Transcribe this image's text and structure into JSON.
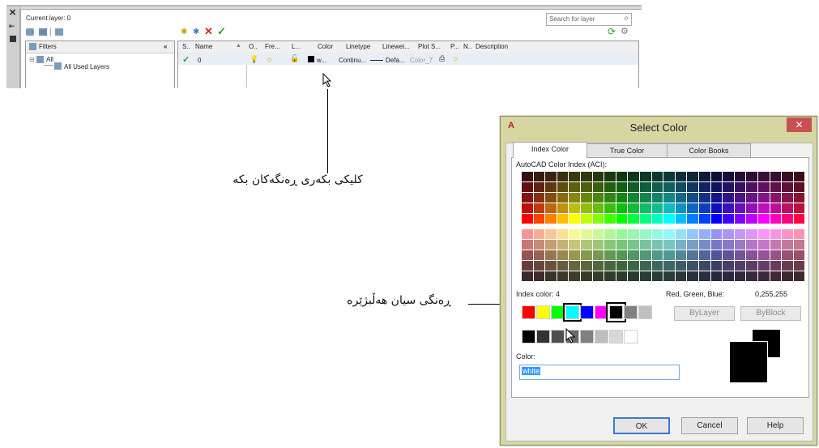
{
  "layer_manager": {
    "current_layer": "Current layer: 0",
    "search_placeholder": "Search for layer",
    "filters_label": "Filters",
    "tree": [
      "All",
      "All Used Layers"
    ],
    "columns": [
      "S..",
      "Name",
      "O..",
      "Fre...",
      "L...",
      "Color",
      "Linetype",
      "Linewei...",
      "Plot S...",
      "P...",
      "N..",
      "Description"
    ],
    "row": {
      "name": "0",
      "color": "w...",
      "linetype": "Continu...",
      "lineweight": "Defa...",
      "plot_style": "Color_7"
    }
  },
  "dialog": {
    "title": "Select Color",
    "tabs": [
      "Index Color",
      "True Color",
      "Color Books"
    ],
    "aci_label": "AutoCAD Color Index (ACI):",
    "index_color_label": "Index color: 4",
    "rgb_label": "Red, Green, Blue:",
    "rgb_value": "0,255,255",
    "bylayer": "ByLayer",
    "byblock": "ByBlock",
    "color_label": "Color:",
    "color_value": "white",
    "ok": "OK",
    "cancel": "Cancel",
    "help": "Help",
    "standard_colors": [
      "#ff0000",
      "#ffff00",
      "#00ff00",
      "#00ffff",
      "#0000ff",
      "#ff00ff",
      "#000000",
      "#808080",
      "#c0c0c0"
    ],
    "gray_colors": [
      "#000000",
      "#333333",
      "#505050",
      "#696969",
      "#808080",
      "#bebebe",
      "#d8d8d8",
      "#ffffff"
    ]
  },
  "annotations": {
    "click_color": "کلیکی بکەری ڕەنگەکان بکە",
    "choose_cyan": "ڕەنگی سیان هەڵبژێرە"
  },
  "colors": {
    "dialog_frame": "#d6d6a3",
    "close_button": "#c75050",
    "selected": "#00ffff",
    "link_blue": "#0066cc"
  }
}
